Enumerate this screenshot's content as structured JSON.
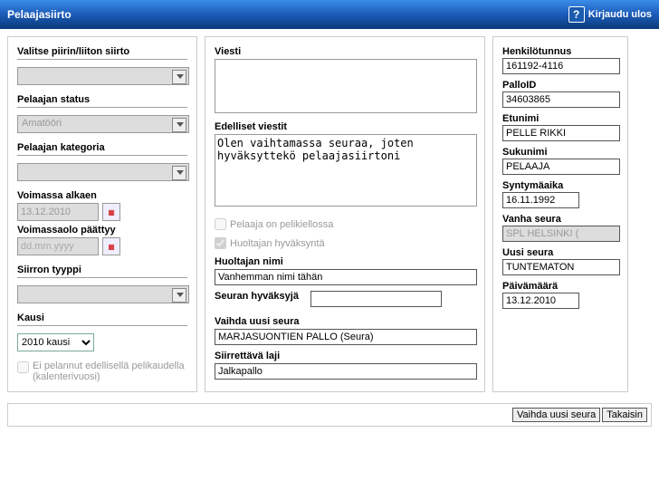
{
  "header": {
    "title": "Pelaajasiirto",
    "helpSymbol": "?",
    "logout": "Kirjaudu ulos"
  },
  "left": {
    "piiriLabel": "Valitse piirin/liiton siirto",
    "piiriValue": "",
    "statusLabel": "Pelaajan status",
    "statusValue": "Amatööri",
    "kategoriaLabel": "Pelaajan kategoria",
    "kategoriaValue": "",
    "voimassaAlkaenLabel": "Voimassa alkaen",
    "voimassaAlkaenValue": "13.12.2010",
    "voimassaoloPaattyyLabel": "Voimassaolo päättyy",
    "voimassaoloPaattyyPlaceholder": "dd.mm.yyyy",
    "siirronTyyppiLabel": "Siirron tyyppi",
    "siirronTyyppiValue": "",
    "kausiLabel": "Kausi",
    "kausiValue": "2010 kausi",
    "eiPelannutLabel": "Ei pelannut edellisellä pelikaudella (kalenterivuosi)"
  },
  "mid": {
    "viestiLabel": "Viesti",
    "viestiValue": "",
    "edellisetLabel": "Edelliset viestit",
    "edellisetValue": "Olen vaihtamassa seuraa, joten hyväksyttekö pelaajasiirtoni",
    "pelikieltoLabel": "Pelaaja on pelikiellossa",
    "huoltajaHyvLabel": "Huoltajan hyväksyntä",
    "huoltajaNimiLabel": "Huoltajan nimi",
    "huoltajaNimiValue": "Vanhemman nimi tähän",
    "seuranHyvaksyjaLabel": "Seuran hyväksyjä",
    "seuranHyvaksyjaValue": "",
    "vaihdaSeuraLabel": "Vaihda uusi seura",
    "vaihdaSeuraValue": "MARJASUONTIEN PALLO (Seura)",
    "siirrettavaLajiLabel": "Siirrettävä laji",
    "siirrettavaLajiValue": "Jalkapallo"
  },
  "right": {
    "hetuLabel": "Henkilötunnus",
    "hetuValue": "161192-4116",
    "palloIdLabel": "PalloID",
    "palloIdValue": "34603865",
    "etunimiLabel": "Etunimi",
    "etunimiValue": "PELLE RIKKI",
    "sukunimiLabel": "Sukunimi",
    "sukunimiValue": "PELAAJA",
    "syntymaaikaLabel": "Syntymäaika",
    "syntymaaikaValue": "16.11.1992",
    "vanhaSeuraLabel": "Vanha seura",
    "vanhaSeuraValue": "SPL HELSINKI (",
    "uusiSeuraLabel": "Uusi seura",
    "uusiSeuraValue": "TUNTEMATON",
    "paivamaaraLabel": "Päivämäärä",
    "paivamaaraValue": "13.12.2010"
  },
  "footer": {
    "vaihdaBtn": "Vaihda uusi seura",
    "takaisinBtn": "Takaisin"
  }
}
